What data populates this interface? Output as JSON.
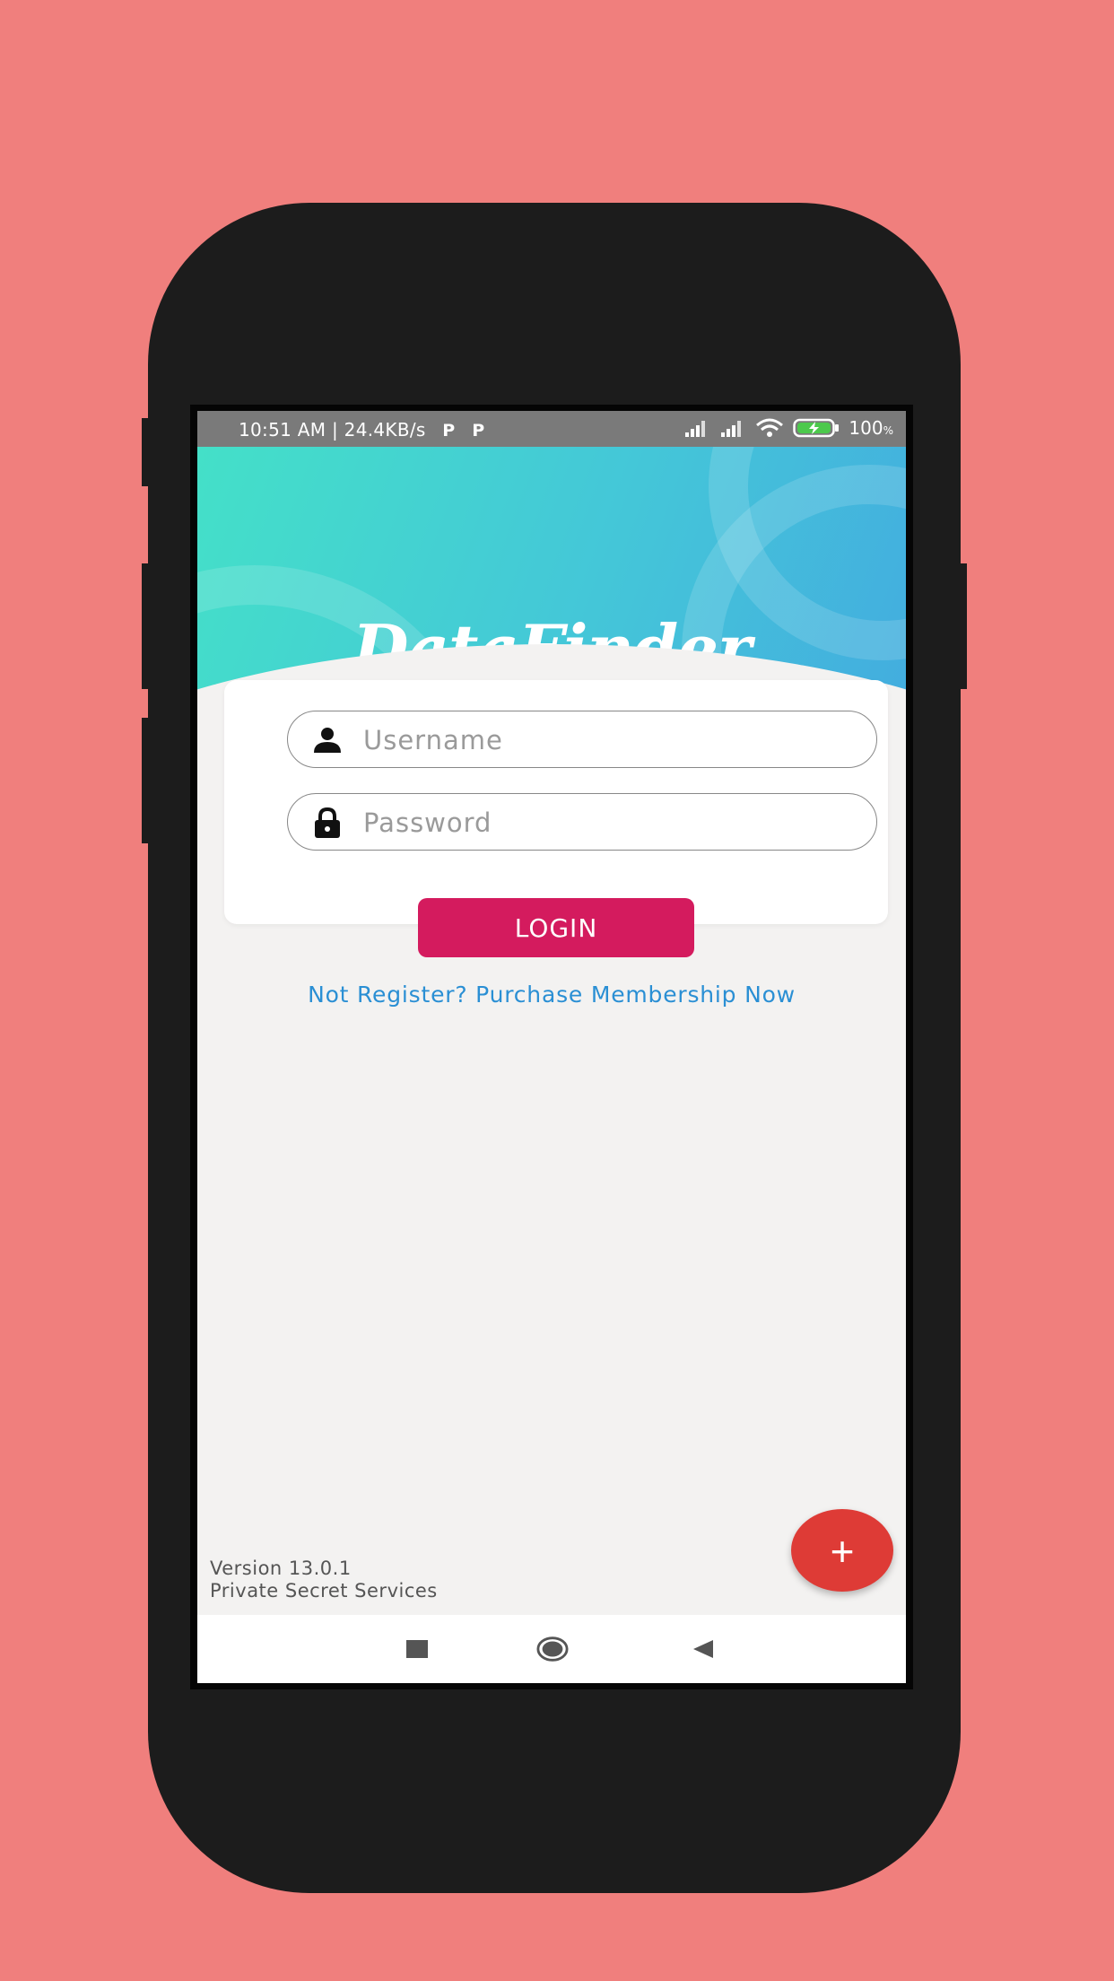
{
  "status_bar": {
    "time_speed": "10:51 AM | 24.4KB/s",
    "badge_1": "P",
    "badge_2": "P",
    "battery": "100",
    "battery_unit": "%"
  },
  "app": {
    "logo": "DataFinder"
  },
  "login_form": {
    "username_placeholder": "Username",
    "password_placeholder": "Password",
    "login_label": "LOGIN",
    "register_link": "Not Register? Purchase Membership Now"
  },
  "footer": {
    "version": "Version 13.0.1",
    "company": "Private Secret Services"
  },
  "fab": {
    "label": "+"
  },
  "icons": {
    "user": "person-icon",
    "lock": "lock-icon",
    "signal": "signal-icon",
    "wifi": "wifi-icon",
    "battery": "battery-charging-icon",
    "nav_recent": "square-icon",
    "nav_home": "circle-icon",
    "nav_back": "triangle-back-icon"
  },
  "colors": {
    "background": "#f07f7d",
    "header_start": "#44e0c8",
    "header_end": "#43addf",
    "login_button": "#d41b5e",
    "link": "#2a8fd4",
    "fab": "#de3b36"
  }
}
